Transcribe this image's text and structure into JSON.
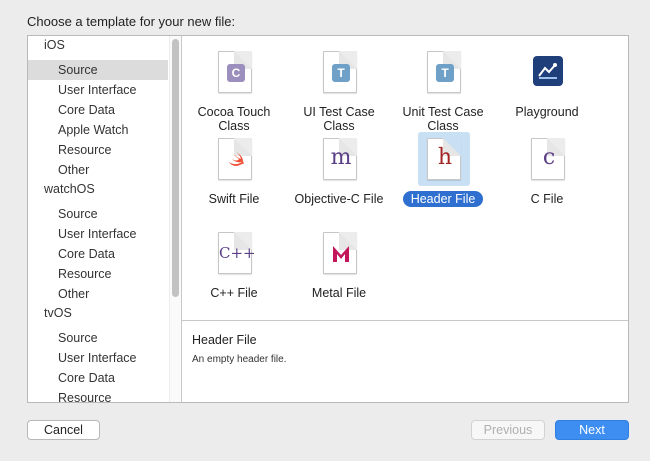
{
  "dialog": {
    "prompt": "Choose a template for your new file:"
  },
  "sidebar": {
    "groups": [
      {
        "platform": "iOS",
        "items": [
          "Source",
          "User Interface",
          "Core Data",
          "Apple Watch",
          "Resource",
          "Other"
        ],
        "selected": 0
      },
      {
        "platform": "watchOS",
        "items": [
          "Source",
          "User Interface",
          "Core Data",
          "Resource",
          "Other"
        ]
      },
      {
        "platform": "tvOS",
        "items": [
          "Source",
          "User Interface",
          "Core Data",
          "Resource"
        ]
      }
    ]
  },
  "templates": [
    {
      "label": "Cocoa Touch Class",
      "icon": "cocoa-touch-class-icon",
      "glyph": "C",
      "color": "#9d8fbd"
    },
    {
      "label": "UI Test Case Class",
      "icon": "ui-test-case-class-icon",
      "glyph": "T",
      "color": "#6fa0c8"
    },
    {
      "label": "Unit Test Case Class",
      "icon": "unit-test-case-class-icon",
      "glyph": "T",
      "color": "#6fa0c8"
    },
    {
      "label": "Playground",
      "icon": "playground-icon",
      "glyph": "",
      "color": "#1e3f7a"
    },
    {
      "label": "Swift File",
      "icon": "swift-file-icon",
      "glyph": "",
      "color": "#ef5138"
    },
    {
      "label": "Objective-C File",
      "icon": "objective-c-file-icon",
      "glyph": "m",
      "color": "#5b3f86"
    },
    {
      "label": "Header File",
      "icon": "header-file-icon",
      "glyph": "h",
      "color": "#a32424",
      "selected": true
    },
    {
      "label": "C File",
      "icon": "c-file-icon",
      "glyph": "c",
      "color": "#5b3f86"
    },
    {
      "label": "C++ File",
      "icon": "cpp-file-icon",
      "glyph": "C++",
      "color": "#5b3f86"
    },
    {
      "label": "Metal File",
      "icon": "metal-file-icon",
      "glyph": "",
      "color": "#c2185b"
    }
  ],
  "description": {
    "title": "Header File",
    "body": "An empty header file."
  },
  "buttons": {
    "cancel": "Cancel",
    "previous": "Previous",
    "next": "Next"
  },
  "colors": {
    "selection": "#2e6fd0",
    "primary_button": "#3d8ef0"
  }
}
